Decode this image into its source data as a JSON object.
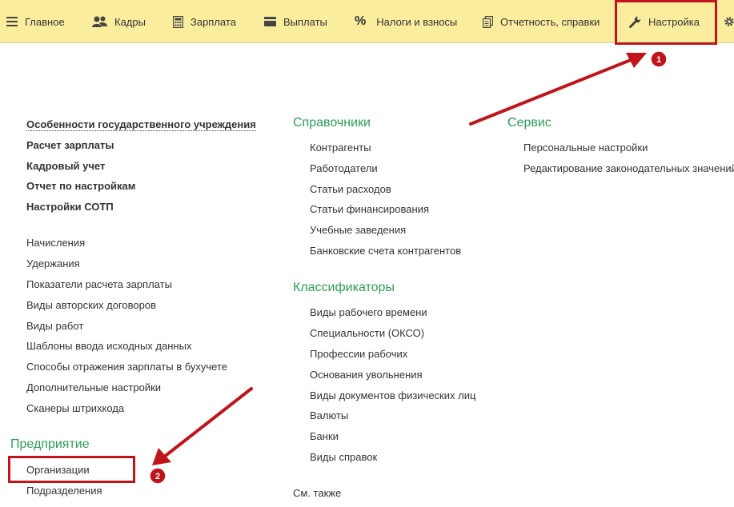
{
  "topbar": {
    "items": [
      {
        "label": "Главное",
        "icon": "hamburger-icon"
      },
      {
        "label": "Кадры",
        "icon": "people-icon"
      },
      {
        "label": "Зарплата",
        "icon": "calculator-icon"
      },
      {
        "label": "Выплаты",
        "icon": "wallet-icon"
      },
      {
        "label": "Налоги и взносы",
        "icon": "percent-icon",
        "glyph": "%"
      },
      {
        "label": "Отчетность, справки",
        "icon": "documents-icon"
      },
      {
        "label": "Настройка",
        "icon": "wrench-icon",
        "active": true
      },
      {
        "label": "",
        "icon": "gear-icon"
      }
    ]
  },
  "left": {
    "bold_links": [
      "Особенности государственного учреждения",
      "Расчет зарплаты",
      "Кадровый учет",
      "Отчет по настройкам",
      "Настройки СОТП"
    ],
    "links": [
      "Начисления",
      "Удержания",
      "Показатели расчета зарплаты",
      "Виды авторских договоров",
      "Виды работ",
      "Шаблоны ввода исходных данных",
      "Способы отражения зарплаты в бухучете",
      "Дополнительные настройки",
      "Сканеры штрихкода"
    ],
    "enterprise": {
      "title": "Предприятие",
      "links": [
        "Организации",
        "Подразделения"
      ]
    }
  },
  "middle": {
    "references": {
      "title": "Справочники",
      "links": [
        "Контрагенты",
        "Работодатели",
        "Статьи расходов",
        "Статьи финансирования",
        "Учебные заведения",
        "Банковские счета контрагентов"
      ]
    },
    "classifiers": {
      "title": "Классификаторы",
      "links": [
        "Виды рабочего времени",
        "Специальности (ОКСО)",
        "Профессии рабочих",
        "Основания увольнения",
        "Виды документов физических лиц",
        "Валюты",
        "Банки",
        "Виды справок"
      ]
    },
    "see_also": "См. также"
  },
  "right": {
    "service": {
      "title": "Сервис",
      "links": [
        "Персональные настройки",
        "Редактирование законодательных значений"
      ]
    }
  },
  "annotations": {
    "badge1": "1",
    "badge2": "2",
    "color": "#c0141b"
  }
}
